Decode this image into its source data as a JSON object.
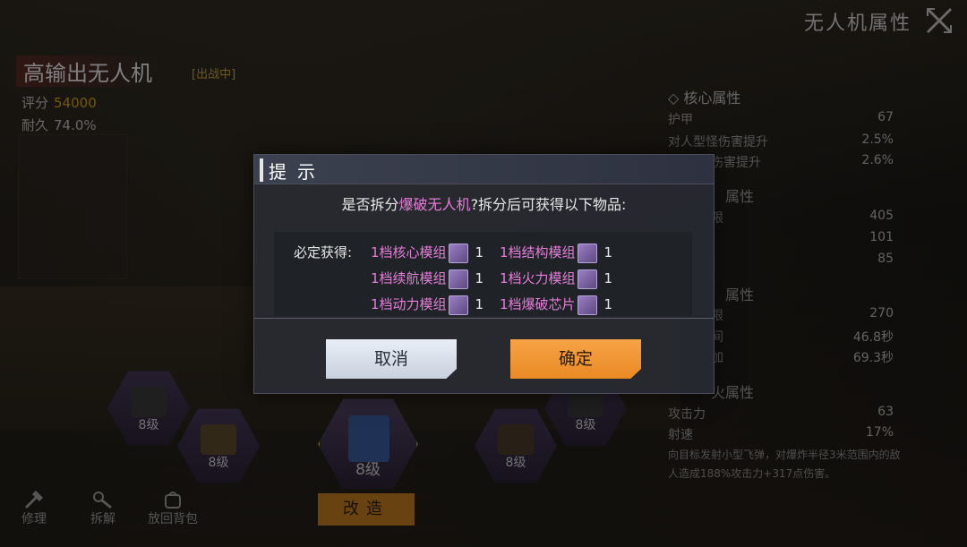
{
  "header": {
    "panel_title": "无人机属性",
    "drone_name": "高输出无人机",
    "status": "[出战中]",
    "score_label": "评分",
    "score_value": "54000",
    "durability_label": "耐久",
    "durability_value": "74.0%"
  },
  "attributes": {
    "core_title": "◇ 核心属性",
    "rows": [
      {
        "name": "护甲",
        "value": "67"
      },
      {
        "name": "对人型怪伤害提升",
        "value": "2.5%"
      },
      {
        "name": "伤害提升",
        "value": "2.6%"
      },
      {
        "name": "属性",
        "value": ""
      },
      {
        "name": "限",
        "value": "405"
      },
      {
        "name": "",
        "value": "101"
      },
      {
        "name": "",
        "value": "85"
      },
      {
        "name": "属性",
        "value": ""
      },
      {
        "name": "限",
        "value": "270"
      },
      {
        "name": "间",
        "value": "46.8秒"
      },
      {
        "name": "加",
        "value": "69.3秒"
      },
      {
        "name": "火属性",
        "value": ""
      },
      {
        "name": "攻击力",
        "value": "63"
      },
      {
        "name": "射速",
        "value": "17%"
      }
    ],
    "desc": "向目标发射小型飞弹，对爆炸半径3米范围内的敌人造成188%攻击力+317点伤害。"
  },
  "modules": [
    {
      "level": "8级"
    },
    {
      "level": "8级"
    },
    {
      "level": "8级"
    },
    {
      "level": "8级"
    },
    {
      "level": "8级"
    }
  ],
  "bottom": {
    "repair": "修理",
    "dismantle": "拆解",
    "return_bag": "放回背包",
    "upgrade": "改造"
  },
  "modal": {
    "title": "提示",
    "msg_prefix": "是否拆分",
    "msg_highlight": "爆破无人机",
    "msg_suffix": "?拆分后可获得以下物品:",
    "items_head": "必定获得:",
    "rewards": [
      {
        "name": "1档核心模组",
        "qty": "1"
      },
      {
        "name": "1档结构模组",
        "qty": "1"
      },
      {
        "name": "1档续航模组",
        "qty": "1"
      },
      {
        "name": "1档火力模组",
        "qty": "1"
      },
      {
        "name": "1档动力模组",
        "qty": "1"
      },
      {
        "name": "1档爆破芯片",
        "qty": "1"
      }
    ],
    "cancel": "取消",
    "confirm": "确定"
  }
}
